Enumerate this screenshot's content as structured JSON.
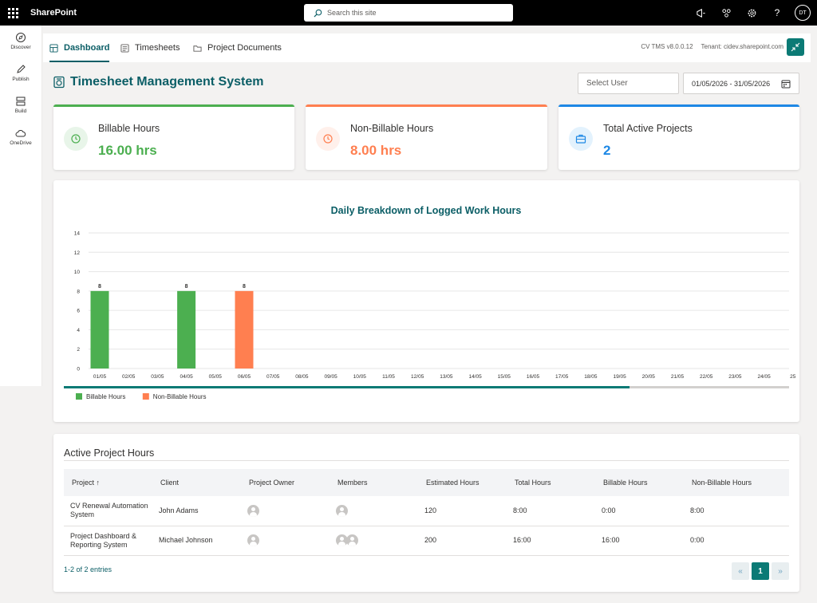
{
  "app": {
    "brand": "SharePoint",
    "search_placeholder": "Search this site",
    "user_initials": "DT"
  },
  "rail": [
    {
      "label": "Discover",
      "icon": "compass-icon"
    },
    {
      "label": "Publish",
      "icon": "pen-icon"
    },
    {
      "label": "Build",
      "icon": "layout-icon"
    },
    {
      "label": "OneDrive",
      "icon": "cloud-icon"
    }
  ],
  "tabs": [
    {
      "label": "Dashboard",
      "icon": "dashboard-icon",
      "active": true
    },
    {
      "label": "Timesheets",
      "icon": "timesheet-icon",
      "active": false
    },
    {
      "label": "Project Documents",
      "icon": "folder-icon",
      "active": false
    }
  ],
  "version": "CV TMS v8.0.0.12",
  "tenant": "Tenant: cidev.sharepoint.com",
  "page_title": "Timesheet Management System",
  "filters": {
    "user_placeholder": "Select User",
    "date_range": "01/05/2026 - 31/05/2026"
  },
  "kpis": {
    "billable": {
      "label": "Billable Hours",
      "value": "16.00 hrs",
      "color": "#4caf50"
    },
    "nonbillable": {
      "label": "Non-Billable Hours",
      "value": "8.00 hrs",
      "color": "#ff7f50"
    },
    "projects": {
      "label": "Total Active Projects",
      "value": "2",
      "color": "#1e88e5"
    }
  },
  "chart_data": {
    "type": "bar",
    "title": "Daily Breakdown of Logged Work Hours",
    "xlabel": "",
    "ylabel": "",
    "ylim": [
      0,
      14
    ],
    "yticks": [
      0,
      2,
      4,
      6,
      8,
      10,
      12,
      14
    ],
    "grid": true,
    "legend": "bottom-left",
    "categories": [
      "01/05",
      "02/05",
      "03/05",
      "04/05",
      "05/05",
      "06/05",
      "07/05",
      "08/05",
      "09/05",
      "10/05",
      "11/05",
      "12/05",
      "13/05",
      "14/05",
      "15/05",
      "16/05",
      "17/05",
      "18/05",
      "19/05",
      "20/05",
      "21/05",
      "22/05",
      "23/05",
      "24/05",
      "25"
    ],
    "series": [
      {
        "name": "Billable Hours",
        "color": "#4caf50",
        "values": [
          8,
          0,
          0,
          8,
          0,
          0,
          0,
          0,
          0,
          0,
          0,
          0,
          0,
          0,
          0,
          0,
          0,
          0,
          0,
          0,
          0,
          0,
          0,
          0,
          0
        ]
      },
      {
        "name": "Non-Billable Hours",
        "color": "#ff7f50",
        "values": [
          0,
          0,
          0,
          0,
          0,
          8,
          0,
          0,
          0,
          0,
          0,
          0,
          0,
          0,
          0,
          0,
          0,
          0,
          0,
          0,
          0,
          0,
          0,
          0,
          0
        ]
      }
    ],
    "data_labels": [
      {
        "category": "01/05",
        "value": "8"
      },
      {
        "category": "04/05",
        "value": "8"
      },
      {
        "category": "06/05",
        "value": "8"
      }
    ],
    "scroll_fraction": 0.78
  },
  "projects": {
    "title": "Active Project Hours",
    "columns": [
      "Project ↑",
      "Client",
      "Project Owner",
      "Members",
      "Estimated Hours",
      "Total Hours",
      "Billable Hours",
      "Non-Billable Hours"
    ],
    "rows": [
      {
        "project": "CV Renewal Automation System",
        "client": "John Adams",
        "owners": 1,
        "members": 1,
        "estimated": "120",
        "total": "8:00",
        "billable": "0:00",
        "nonbillable": "8:00"
      },
      {
        "project": "Project Dashboard & Reporting System",
        "client": "Michael Johnson",
        "owners": 1,
        "members": 2,
        "estimated": "200",
        "total": "16:00",
        "billable": "16:00",
        "nonbillable": "0:00"
      }
    ],
    "entries": "1-2 of 2 entries",
    "pager": {
      "prev": "«",
      "current": "1",
      "next": "»"
    }
  }
}
